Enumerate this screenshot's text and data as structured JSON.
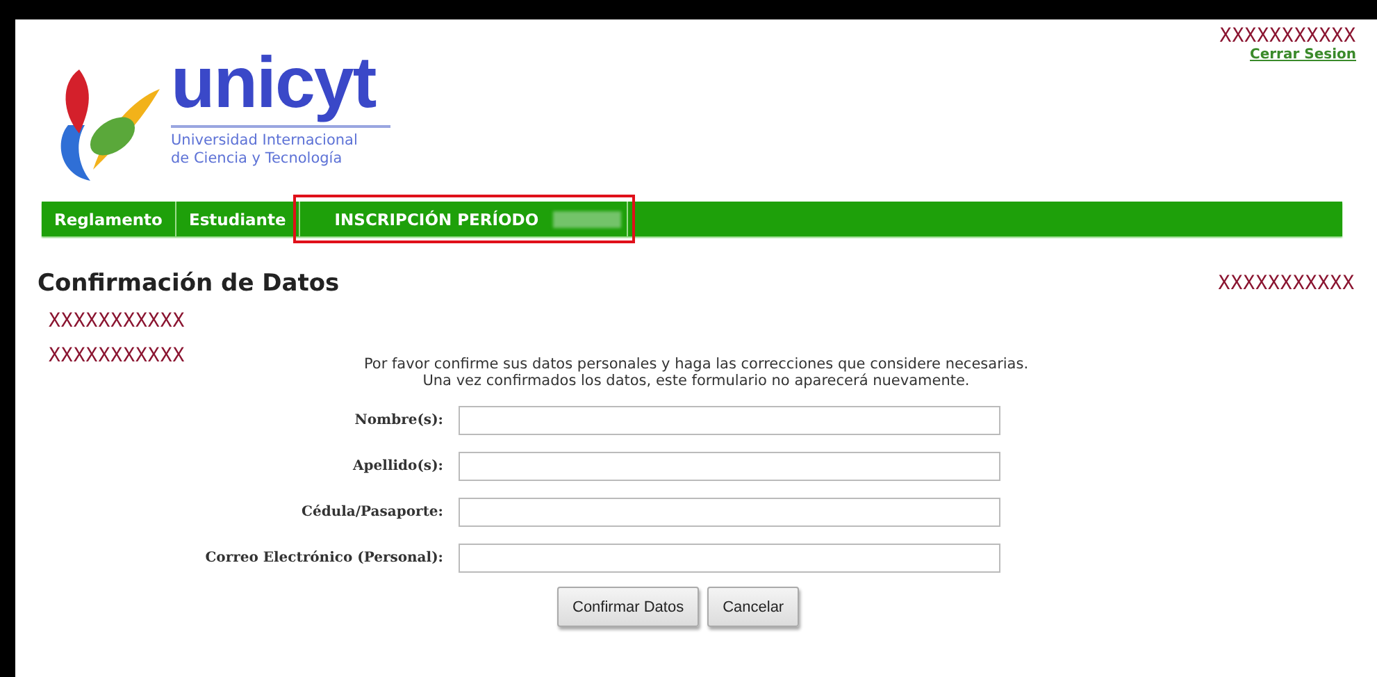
{
  "header": {
    "logo_name": "unicyt",
    "logo_subtitle": [
      "Universidad Internacional",
      "de Ciencia y Tecnología"
    ],
    "user_name": "XXXXXXXXXXX",
    "logout_link": "Cerrar Sesion"
  },
  "nav": {
    "items": [
      {
        "label": "Reglamento",
        "highlighted": false,
        "blurred": false
      },
      {
        "label": "Estudiante",
        "highlighted": false,
        "blurred": false
      },
      {
        "label": "INSCRIPCIÓN PERÍODO",
        "highlighted": true,
        "blurred": true
      }
    ]
  },
  "page": {
    "title": "Confirmación de Datos",
    "right_note": "XXXXXXXXXXX",
    "info_lines": [
      "XXXXXXXXXXX",
      "XXXXXXXXXXX"
    ],
    "instructions": [
      "Por favor confirme sus datos personales y haga las correcciones que considere necesarias.",
      "Una vez confirmados los datos, este formulario no aparecerá nuevamente."
    ]
  },
  "form": {
    "fields": [
      {
        "label": "Nombre(s):"
      },
      {
        "label": "Apellido(s):"
      },
      {
        "label": "Cédula/Pasaporte:"
      },
      {
        "label": "Correo Electrónico (Personal):"
      }
    ],
    "buttons": [
      "Confirmar Datos",
      "Cancelar"
    ]
  }
}
